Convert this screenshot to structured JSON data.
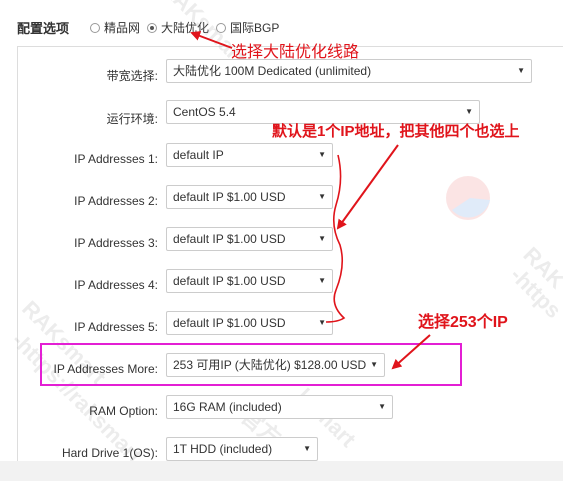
{
  "header": {
    "section_label": "配置选项",
    "radios": [
      {
        "label": "精品网",
        "checked": false
      },
      {
        "label": "大陆优化",
        "checked": true
      },
      {
        "label": "国际BGP",
        "checked": false
      }
    ]
  },
  "fields": {
    "bandwidth": {
      "label": "带宽选择:",
      "value": "大陆优化 100M Dedicated (unlimited)"
    },
    "os": {
      "label": "运行环境:",
      "value": "CentOS 5.4"
    },
    "ip1": {
      "label": "IP Addresses 1:",
      "value": "default IP"
    },
    "ip2": {
      "label": "IP Addresses 2:",
      "value": "default IP $1.00 USD"
    },
    "ip3": {
      "label": "IP Addresses 3:",
      "value": "default IP $1.00 USD"
    },
    "ip4": {
      "label": "IP Addresses 4:",
      "value": "default IP $1.00 USD"
    },
    "ip5": {
      "label": "IP Addresses 5:",
      "value": "default IP $1.00 USD"
    },
    "ip_more": {
      "label": "IP Addresses More:",
      "value": "253 可用IP (大陆优化) $128.00 USD"
    },
    "ram": {
      "label": "RAM Option:",
      "value": "16G RAM (included)"
    },
    "hdd": {
      "label": "Hard Drive 1(OS):",
      "value": "1T HDD (included)"
    }
  },
  "annotations": {
    "choose_route": "选择大陆优化线路",
    "default_ip_note": "默认是1个IP地址，把其他四个也选上",
    "choose_253": "选择253个IP"
  },
  "watermark": {
    "text_1": "RAKsmart",
    "text_2": "-http",
    "text_3": "RAKsmart",
    "text_4": "-https://raksmart",
    "text_5": "官方",
    "text_6": "RAK",
    "text_7": "-https",
    "text_8": "ksmart"
  },
  "icons": {
    "dropdown": "▼"
  },
  "colors": {
    "annotation": "#e0141b",
    "highlight": "#e31fd4"
  }
}
